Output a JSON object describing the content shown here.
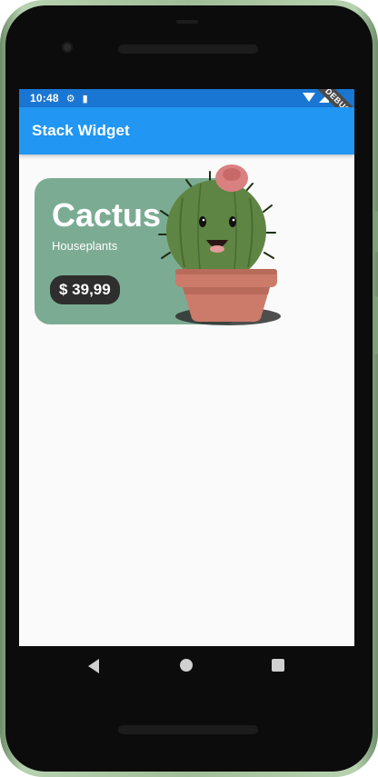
{
  "status_bar": {
    "time": "10:48",
    "settings_icon": "gear-icon",
    "sim_icon": "sim-card-icon",
    "debug_label": "DEBUG"
  },
  "app_bar": {
    "title": "Stack Widget"
  },
  "card": {
    "title": "Cactus",
    "subtitle": "Houseplants",
    "price": "$ 39,99",
    "image_icon": "cactus-icon"
  },
  "colors": {
    "app_bar": "#2196f3",
    "status_bar": "#1976d2",
    "card_background": "#7cab93",
    "price_pill": "#2e2e2e"
  }
}
